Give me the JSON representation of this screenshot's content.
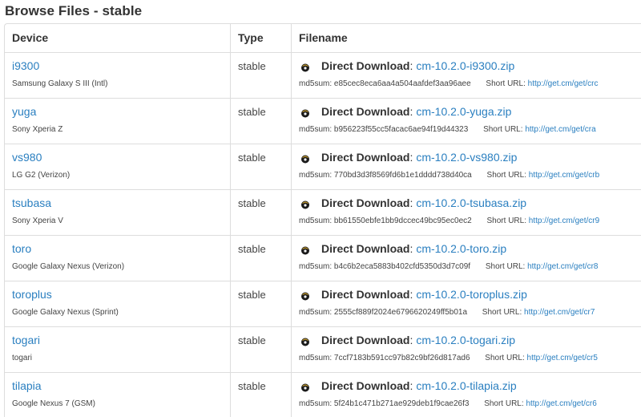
{
  "page": {
    "title": "Browse Files - stable"
  },
  "table": {
    "headers": {
      "device": "Device",
      "type": "Type",
      "filename": "Filename"
    },
    "direct_download_label": "Direct Download",
    "md5_label": "md5sum:",
    "short_url_label": "Short URL:",
    "rows": [
      {
        "device": "i9300",
        "device_name": "Samsung Galaxy S III (Intl)",
        "type": "stable",
        "filename": "cm-10.2.0-i9300.zip",
        "md5": "e85cec8eca6aa4a504aafdef3aa96aee",
        "short_url": "http://get.cm/get/crc"
      },
      {
        "device": "yuga",
        "device_name": "Sony Xperia Z",
        "type": "stable",
        "filename": "cm-10.2.0-yuga.zip",
        "md5": "b956223f55cc5facac6ae94f19d44323",
        "short_url": "http://get.cm/get/cra"
      },
      {
        "device": "vs980",
        "device_name": "LG G2 (Verizon)",
        "type": "stable",
        "filename": "cm-10.2.0-vs980.zip",
        "md5": "770bd3d3f8569fd6b1e1dddd738d40ca",
        "short_url": "http://get.cm/get/crb"
      },
      {
        "device": "tsubasa",
        "device_name": "Sony Xperia V",
        "type": "stable",
        "filename": "cm-10.2.0-tsubasa.zip",
        "md5": "bb61550ebfe1bb9dccec49bc95ec0ec2",
        "short_url": "http://get.cm/get/cr9"
      },
      {
        "device": "toro",
        "device_name": "Google Galaxy Nexus (Verizon)",
        "type": "stable",
        "filename": "cm-10.2.0-toro.zip",
        "md5": "b4c6b2eca5883b402cfd5350d3d7c09f",
        "short_url": "http://get.cm/get/cr8"
      },
      {
        "device": "toroplus",
        "device_name": "Google Galaxy Nexus (Sprint)",
        "type": "stable",
        "filename": "cm-10.2.0-toroplus.zip",
        "md5": "2555cf889f2024e6796620249ff5b01a",
        "short_url": "http://get.cm/get/cr7"
      },
      {
        "device": "togari",
        "device_name": "togari",
        "type": "stable",
        "filename": "cm-10.2.0-togari.zip",
        "md5": "7ccf7183b591cc97b82c9bf26d817ad6",
        "short_url": "http://get.cm/get/cr5"
      },
      {
        "device": "tilapia",
        "device_name": "Google Nexus 7 (GSM)",
        "type": "stable",
        "filename": "cm-10.2.0-tilapia.zip",
        "md5": "5f24b1c471b271ae929deb1f9cae26f3",
        "short_url": "http://get.cm/get/cr6"
      }
    ]
  },
  "icons": {
    "download": "cid-head-icon"
  }
}
